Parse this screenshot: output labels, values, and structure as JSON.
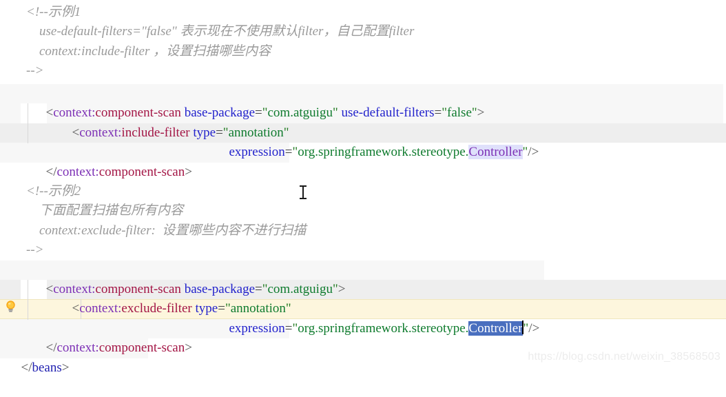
{
  "editor": {
    "watermark": "https://blog.csdn.net/weixin_38568503",
    "gutter": {
      "bulb_icon": "lightbulb-icon",
      "bulb_tooltip": "Show intention actions"
    },
    "mouse_cursor": "text-ibeam-cursor",
    "colors": {
      "background": "#ffffff",
      "namespace": "#7c2fb5",
      "tag": "#a31545",
      "tag_blue": "#2020b0",
      "attribute": "#2222cc",
      "value": "#0f7b2e",
      "comment": "#9a9a9a",
      "bracket": "#555555",
      "band_gray": "#eeeeee",
      "band_faint": "#f7f7f7",
      "current_line": "#fdf6dd",
      "occurrence_highlight": "#dfe0fb",
      "selection": "#4a6fbf",
      "watermark": "#ececec"
    }
  },
  "code": {
    "comment_block_1": {
      "line_1": "<!--示例1",
      "line_2": "    use-default-filters=\"false\" 表示现在不使用默认filter，自己配置filter",
      "line_3": "    context:include-filter ，设置扫描哪些内容",
      "line_4": "-->"
    },
    "block_1": {
      "open_bracket": "<",
      "ns": "context:",
      "tag": "component-scan",
      "attr_1": "base-package",
      "val_1": "com.atguigu",
      "attr_2": "use-default-filters",
      "val_2": "false",
      "close_bracket": ">",
      "child_open_bracket": "<",
      "child_ns": "context:",
      "child_tag": "include-filter",
      "child_attr_1": "type",
      "child_val_1": "annotation",
      "child_attr_2": "expression",
      "child_val_prefix": "org.springframework.stereotype.",
      "child_val_highlight": "Controller",
      "child_self_close": "/>",
      "closing": "</",
      "closing_ns": "context:",
      "closing_tag": "component-scan",
      "closing_bracket": ">"
    },
    "comment_block_2": {
      "line_1": "<!--示例2",
      "line_2": "    下面配置扫描包所有内容",
      "line_3": "    context:exclude-filter:  设置哪些内容不进行扫描",
      "line_4": "-->"
    },
    "block_2": {
      "open_bracket": "<",
      "ns": "context:",
      "tag": "component-scan",
      "attr_1": "base-package",
      "val_1": "com.atguigu",
      "close_bracket": ">",
      "child_open_bracket": "<",
      "child_ns": "context:",
      "child_tag": "exclude-filter",
      "child_attr_1": "type",
      "child_val_1": "annotation",
      "child_attr_2": "expression",
      "child_val_prefix": "org.springframework.stereotype.",
      "child_val_selected": "Controller",
      "child_self_close": "/>",
      "closing": "</",
      "closing_ns": "context:",
      "closing_tag": "component-scan",
      "closing_bracket": ">"
    },
    "root_close": {
      "open": "</",
      "tag": "beans",
      "close": ">"
    },
    "punct": {
      "eq": "=",
      "quote": "\"",
      "space": " "
    }
  }
}
